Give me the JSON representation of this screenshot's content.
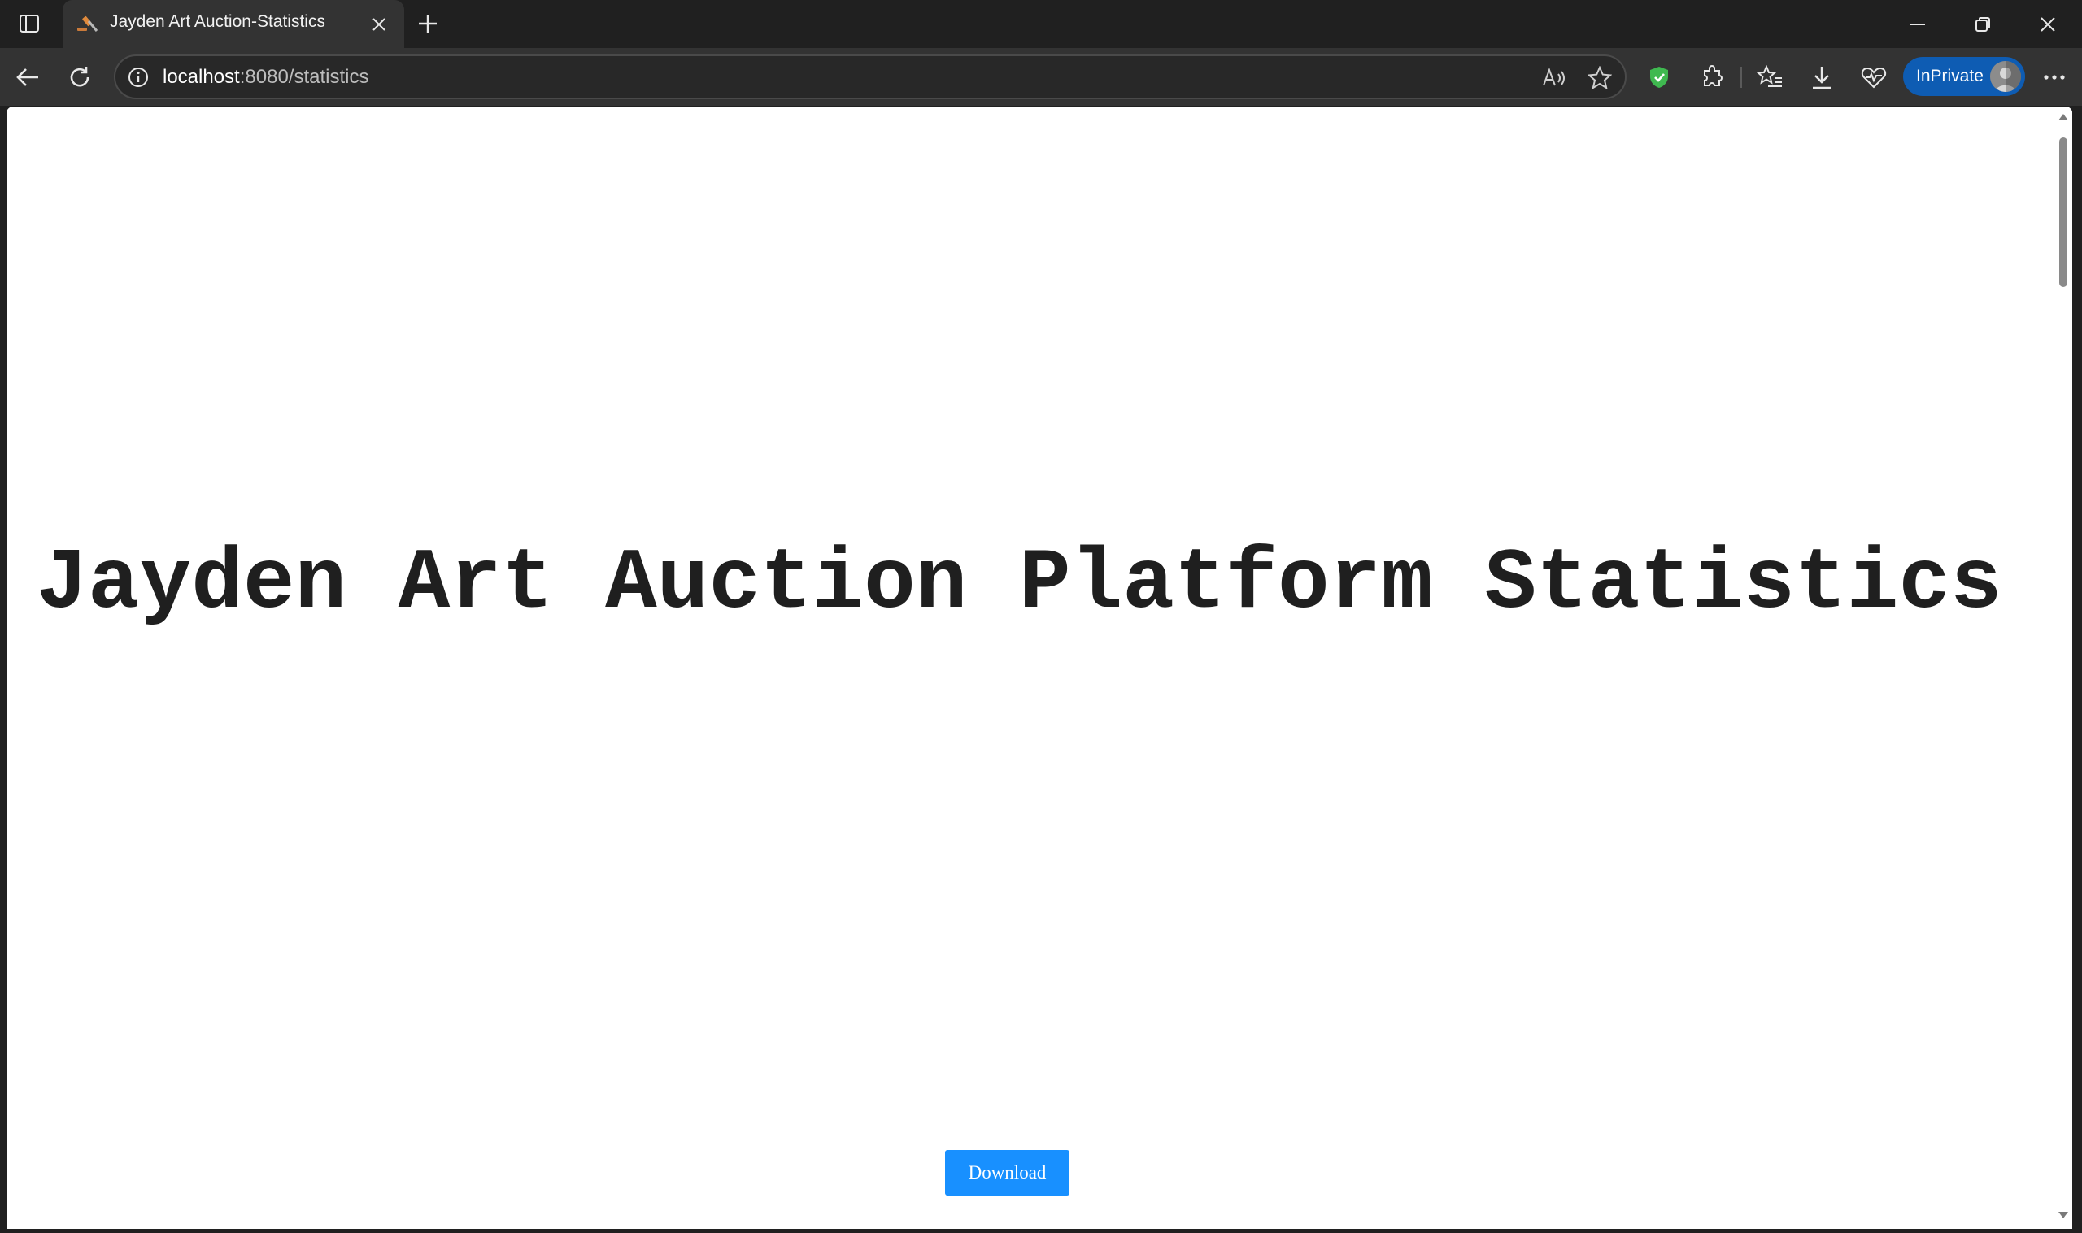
{
  "browser": {
    "tab": {
      "title": "Jayden Art Auction-Statistics"
    },
    "address_bar": {
      "host": "localhost",
      "path": ":8080/statistics"
    },
    "profile": {
      "label": "InPrivate"
    },
    "colors": {
      "accent": "#1890ff",
      "inprivate": "#0e5cb3",
      "shield": "#3fb950"
    }
  },
  "page": {
    "heading": "Jayden Art Auction Platform Statistics",
    "download_label": "Download"
  }
}
